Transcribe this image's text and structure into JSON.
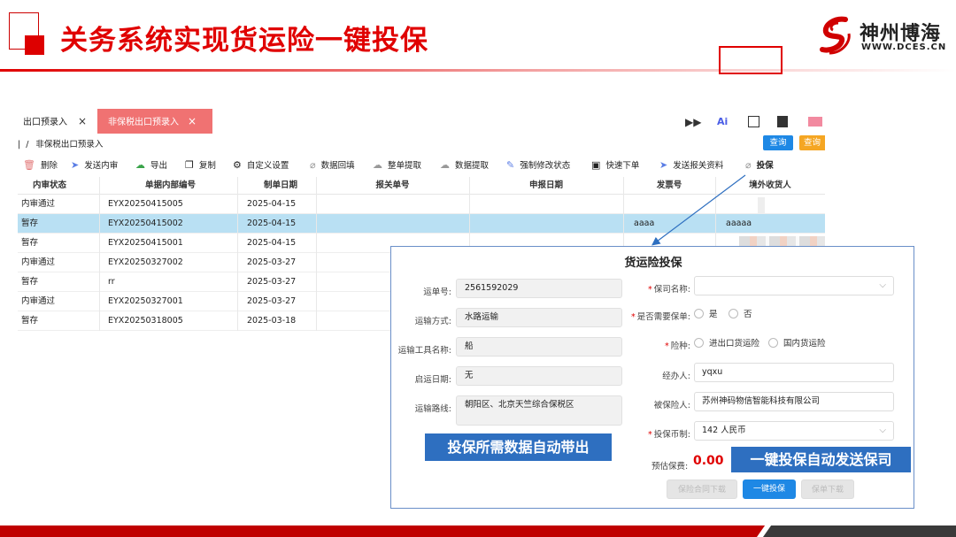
{
  "slide": {
    "title": "关务系统实现货运险一键投保",
    "logo_cn": "神州博海",
    "logo_en": "WWW.DCES.CN",
    "colors": {
      "accent": "#e00000",
      "footer_dark": "#3a3a3a",
      "primary_button": "#1e88e5",
      "callout": "#2e6fc0"
    }
  },
  "app": {
    "tabs": [
      {
        "label": "出口预录入",
        "close": "×",
        "active": false
      },
      {
        "label": "非保税出口预录入",
        "close": "×",
        "active": true
      }
    ],
    "top_icons": [
      "fast-forward-icon",
      "ai-icon",
      "scan-icon",
      "document-icon",
      "mail-icon"
    ],
    "ai_label": "Ai",
    "ff_glyph": "▶▶",
    "breadcrumb": {
      "prefix": "|",
      "sep": "/",
      "current": "非保税出口预录入"
    },
    "query_label": "查询",
    "query2_label": "查询",
    "toolbar": [
      {
        "label": "删除",
        "icon": "trash-icon",
        "glyph": "🗑"
      },
      {
        "label": "发送内审",
        "icon": "send-icon",
        "glyph": "➤"
      },
      {
        "label": "导出",
        "icon": "cloud-download-icon",
        "glyph": "☁"
      },
      {
        "label": "复制",
        "icon": "copy-icon",
        "glyph": "❐"
      },
      {
        "label": "自定义设置",
        "icon": "gear-icon",
        "glyph": "⚙"
      },
      {
        "label": "数据回填",
        "icon": "paperclip-icon",
        "glyph": "⌀"
      },
      {
        "label": "整单提取",
        "icon": "cloud-icon",
        "glyph": "☁"
      },
      {
        "label": "数据提取",
        "icon": "cloud-icon",
        "glyph": "☁"
      },
      {
        "label": "强制修改状态",
        "icon": "edit-icon",
        "glyph": "✎"
      },
      {
        "label": "快速下单",
        "icon": "download-box-icon",
        "glyph": "▣"
      },
      {
        "label": "发送报关资料",
        "icon": "send-icon",
        "glyph": "➤"
      },
      {
        "label": "投保",
        "icon": "paperclip-icon",
        "glyph": "⌀"
      }
    ],
    "table": {
      "columns": [
        "内审状态",
        "单据内部编号",
        "制单日期",
        "报关单号",
        "申报日期",
        "发票号",
        "境外收货人"
      ],
      "rows": [
        {
          "status": "内审通过",
          "id": "EYX20250415005",
          "date": "2025-04-15",
          "customs_no": "",
          "decl_date": "",
          "invoice": "",
          "consignee": "",
          "selected": false
        },
        {
          "status": "暂存",
          "id": "EYX20250415002",
          "date": "2025-04-15",
          "customs_no": "",
          "decl_date": "",
          "invoice": "aaaa",
          "consignee": "aaaaa",
          "selected": true
        },
        {
          "status": "暂存",
          "id": "EYX20250415001",
          "date": "2025-04-15",
          "customs_no": "",
          "decl_date": "",
          "invoice": "",
          "consignee": "",
          "selected": false
        },
        {
          "status": "内审通过",
          "id": "EYX20250327002",
          "date": "2025-03-27",
          "customs_no": "",
          "decl_date": "",
          "invoice": "",
          "consignee": "",
          "selected": false
        },
        {
          "status": "暂存",
          "id": "rr",
          "date": "2025-03-27",
          "customs_no": "",
          "decl_date": "",
          "invoice": "",
          "consignee": "",
          "selected": false
        },
        {
          "status": "内审通过",
          "id": "EYX20250327001",
          "date": "2025-03-27",
          "customs_no": "",
          "decl_date": "",
          "invoice": "",
          "consignee": "",
          "selected": false
        },
        {
          "status": "暂存",
          "id": "EYX20250318005",
          "date": "2025-03-18",
          "customs_no": "",
          "decl_date": "",
          "invoice": "",
          "consignee": "",
          "selected": false
        }
      ]
    }
  },
  "dialog": {
    "title": "货运险投保",
    "left_fields": [
      {
        "label": "运单号:",
        "value": "2561592029"
      },
      {
        "label": "运输方式:",
        "value": "水路运输"
      },
      {
        "label": "运输工具名称:",
        "value": "船"
      },
      {
        "label": "启运日期:",
        "value": "无"
      },
      {
        "label": "运输路线:",
        "value": "朝阳区、北京天竺综合保税区"
      }
    ],
    "insurer": {
      "label": "保司名称:",
      "value": ""
    },
    "need_policy": {
      "label": "是否需要保单:",
      "options": [
        "是",
        "否"
      ]
    },
    "insurance_type": {
      "label": "险种:",
      "options": [
        "进出口货运险",
        "国内货运险"
      ]
    },
    "handler": {
      "label": "经办人:",
      "value": "yqxu"
    },
    "insured": {
      "label": "被保险人:",
      "value": "苏州神码物信智能科技有限公司"
    },
    "currency": {
      "label": "投保币制:",
      "value": "142 人民币"
    },
    "premium": {
      "label": "预估保费:",
      "value": "0.00"
    },
    "buttons": {
      "download_contract": "保险合同下载",
      "one_click": "一键投保",
      "policy_download": "保单下载"
    },
    "required_mark": "*",
    "chevron": "⌵"
  },
  "callouts": {
    "auto_fill": "投保所需数据自动带出",
    "auto_send": "一键投保自动发送保司"
  }
}
